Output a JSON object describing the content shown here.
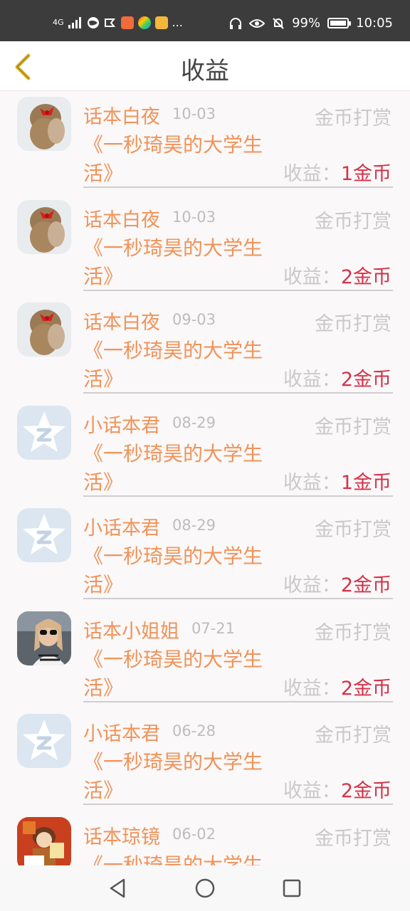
{
  "status_bar": {
    "network": "4G",
    "more": "...",
    "battery": "99%",
    "time": "10:05"
  },
  "header": {
    "title": "收益",
    "back_icon": "chevron-left-icon"
  },
  "income_prefix": "收益：",
  "items": [
    {
      "name": "话本白夜",
      "date": "10-03",
      "type": "金币打赏",
      "title1": "《一秒琦昊的大学生",
      "title2": "活》",
      "amount": "1金币",
      "avatar": "girl-red-bow"
    },
    {
      "name": "话本白夜",
      "date": "10-03",
      "type": "金币打赏",
      "title1": "《一秒琦昊的大学生",
      "title2": "活》",
      "amount": "2金币",
      "avatar": "girl-red-bow"
    },
    {
      "name": "话本白夜",
      "date": "09-03",
      "type": "金币打赏",
      "title1": "《一秒琦昊的大学生",
      "title2": "活》",
      "amount": "2金币",
      "avatar": "girl-red-bow"
    },
    {
      "name": "小话本君",
      "date": "08-29",
      "type": "金币打赏",
      "title1": "《一秒琦昊的大学生",
      "title2": "活》",
      "amount": "1金币",
      "avatar": "default-star"
    },
    {
      "name": "小话本君",
      "date": "08-29",
      "type": "金币打赏",
      "title1": "《一秒琦昊的大学生",
      "title2": "活》",
      "amount": "2金币",
      "avatar": "default-star"
    },
    {
      "name": "话本小姐姐",
      "date": "07-21",
      "type": "金币打赏",
      "title1": "《一秒琦昊的大学生",
      "title2": "活》",
      "amount": "2金币",
      "avatar": "girl-sunglasses"
    },
    {
      "name": "小话本君",
      "date": "06-28",
      "type": "金币打赏",
      "title1": "《一秒琦昊的大学生",
      "title2": "活》",
      "amount": "2金币",
      "avatar": "default-star"
    },
    {
      "name": "话本琼镜",
      "date": "06-02",
      "type": "金币打赏",
      "title1": "《一秒琦昊的大学生",
      "title2": "",
      "amount": "",
      "avatar": "illustrated-character"
    }
  ],
  "colors": {
    "accent_orange": "#f0935a",
    "amount_red": "#d6324a",
    "muted_gray": "#c9c9c9",
    "back_arrow": "#e0b42a"
  }
}
